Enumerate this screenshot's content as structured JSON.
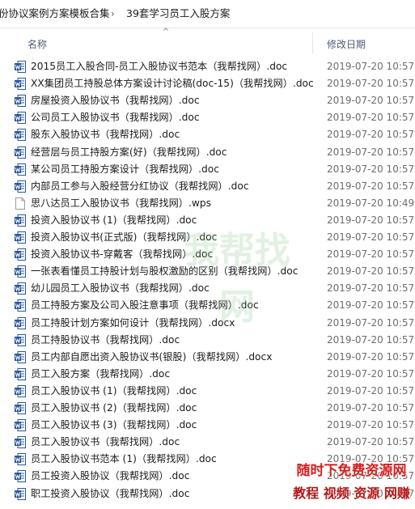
{
  "breadcrumb": {
    "parent": "份协议案例方案模板合集",
    "separator": "›",
    "current": "39套学习员工入股方案"
  },
  "columns": {
    "name": "名称",
    "modified": "修改日期",
    "sort_glyph": "^"
  },
  "files": [
    {
      "name": "2015员工入股合同-员工入股协议书范本（我帮找网）.doc",
      "date": "2019-07-20 10:57",
      "icon": "word-doc-icon"
    },
    {
      "name": "XX集团员工持股总体方案设计讨论稿(doc-15)（我帮找网）.doc",
      "date": "2019-07-20 10:57",
      "icon": "word-doc-icon"
    },
    {
      "name": "房屋投资入股协议书（我帮找网）.doc",
      "date": "2019-07-20 10:57",
      "icon": "word-doc-icon"
    },
    {
      "name": "公司员工入股协议书（我帮找网）.doc",
      "date": "2019-07-20 10:57",
      "icon": "word-doc-icon"
    },
    {
      "name": "股东入股协议书（我帮找网）.doc",
      "date": "2019-07-20 10:57",
      "icon": "word-doc-icon"
    },
    {
      "name": "经营层与员工持股方案(好)（我帮找网）.doc",
      "date": "2019-07-20 10:57",
      "icon": "word-doc-icon"
    },
    {
      "name": "某公司员工持股方案设计（我帮找网）.doc",
      "date": "2019-07-20 10:57",
      "icon": "word-doc-icon"
    },
    {
      "name": "内部员工参与入股经营分红协议（我帮找网）.doc",
      "date": "2019-07-20 10:57",
      "icon": "word-doc-icon"
    },
    {
      "name": "思八达员工入股协议书（我帮找网）.wps",
      "date": "2019-07-20 10:49",
      "icon": "blank-file-icon"
    },
    {
      "name": "投资入股协议书 (1)（我帮找网）.doc",
      "date": "2019-07-20 10:57",
      "icon": "word-doc-icon"
    },
    {
      "name": "投资入股协议书(正式版)（我帮找网）.doc",
      "date": "2019-07-20 10:57",
      "icon": "word-doc-icon"
    },
    {
      "name": "投资入股协议书-穿戴客（我帮找网）.doc",
      "date": "2019-07-20 10:57",
      "icon": "word-doc-icon"
    },
    {
      "name": "一张表看懂员工持股计划与股权激励的区别（我帮找网）.doc",
      "date": "2019-07-20 10:57",
      "icon": "word-doc-icon"
    },
    {
      "name": "幼儿园员工入股协议书（我帮找网）.doc",
      "date": "2019-07-20 10:57",
      "icon": "word-doc-icon"
    },
    {
      "name": "员工持股方案及公司入股注意事项（我帮找网）.doc",
      "date": "2019-07-20 10:57",
      "icon": "word-doc-icon"
    },
    {
      "name": "员工持股计划方案如何设计（我帮找网）.docx",
      "date": "2019-07-20 10:57",
      "icon": "word-docx-icon"
    },
    {
      "name": "员工持股协议书（我帮找网）.doc",
      "date": "2019-07-20 10:57",
      "icon": "word-doc-icon"
    },
    {
      "name": "员工内部自愿出资入股协议书(银股)（我帮找网）.docx",
      "date": "2019-07-20 10:57",
      "icon": "word-docx-icon"
    },
    {
      "name": "员工入股方案（我帮找网）.doc",
      "date": "2019-07-20 10:57",
      "icon": "word-doc-icon"
    },
    {
      "name": "员工入股协议书 (1)（我帮找网）.doc",
      "date": "2019-07-20 10:57",
      "icon": "word-doc-icon"
    },
    {
      "name": "员工入股协议书 (2)（我帮找网）.doc",
      "date": "2019-07-20 10:57",
      "icon": "word-doc-icon"
    },
    {
      "name": "员工入股协议书 (3)（我帮找网）.doc",
      "date": "2019-07-20 10:57",
      "icon": "word-doc-icon"
    },
    {
      "name": "员工入股协议书（我帮找网）.doc",
      "date": "2019-07-20 10:57",
      "icon": "word-doc-icon"
    },
    {
      "name": "员工入股协议书范本 (1)（我帮找网）.doc",
      "date": "2019-07-20 10:57",
      "icon": "word-doc-icon"
    },
    {
      "name": "员工投资入股协议（我帮找网）.doc",
      "date": "2019-07-20 10:57",
      "icon": "word-doc-icon"
    },
    {
      "name": "职工投资入股协议（我帮找网）.doc",
      "date": "2019-07-20 10:57",
      "icon": "word-doc-icon"
    }
  ],
  "watermark": {
    "center_text": "我帮找网",
    "corner_line1": "随时下免费资源网",
    "corner_line2": "教程 视频 资源 网赚"
  },
  "colors": {
    "word_blue": "#2b579a",
    "header_text": "#4d5a78",
    "date_text": "#6d6d6d",
    "watermark_red": "#d42020"
  }
}
